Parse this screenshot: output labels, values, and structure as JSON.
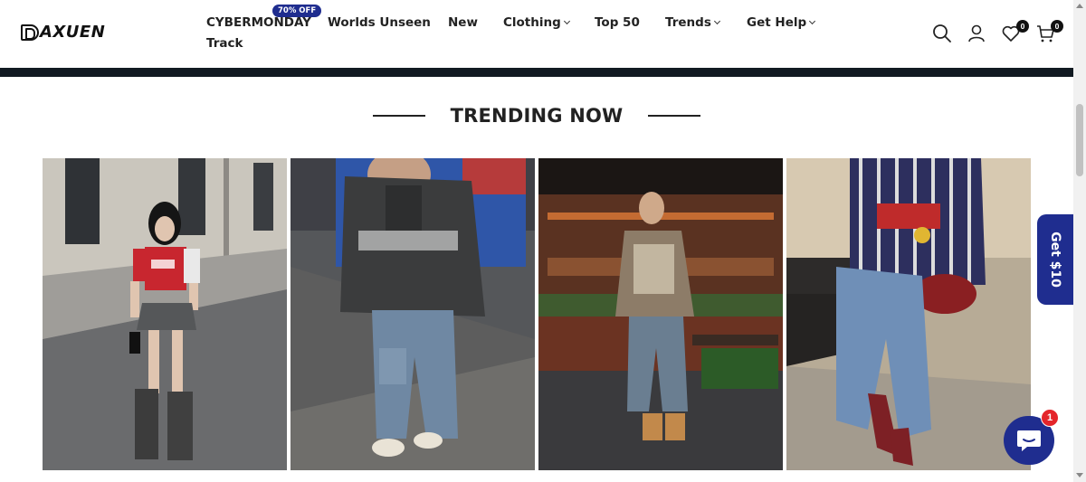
{
  "header": {
    "logo_text": "AXUEN",
    "nav": [
      {
        "label": "CYBERMONDAY",
        "has_chevron": false
      },
      {
        "label": "Worlds Unseen",
        "has_chevron": false
      },
      {
        "label": "New",
        "has_chevron": false
      },
      {
        "label": "Clothing",
        "has_chevron": true
      },
      {
        "label": "Top 50",
        "has_chevron": false
      },
      {
        "label": "Trends",
        "has_chevron": true
      },
      {
        "label": "Get Help",
        "has_chevron": true
      },
      {
        "label": "Track",
        "has_chevron": false
      }
    ],
    "promo_badge": "70% OFF",
    "wishlist_count": "0",
    "cart_count": "0"
  },
  "section": {
    "title": "TRENDING NOW"
  },
  "side_tab": {
    "label": "Get $10"
  },
  "chat": {
    "unread": "1"
  },
  "colors": {
    "brand": "#1f2d8f",
    "dark_bar": "#111a22",
    "badge_red": "#e4252b"
  },
  "icons": [
    "search-icon",
    "account-icon",
    "wishlist-icon",
    "cart-icon",
    "chat-icon"
  ]
}
